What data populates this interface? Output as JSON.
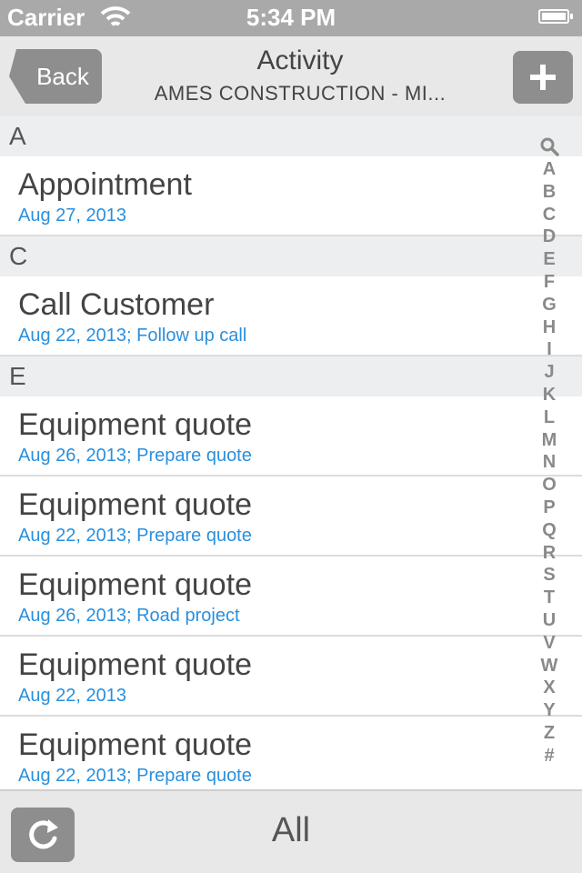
{
  "status_bar": {
    "carrier": "Carrier",
    "time": "5:34 PM"
  },
  "nav": {
    "back_label": "Back",
    "title": "Activity",
    "subtitle": "AMES CONSTRUCTION - MI...",
    "add_icon": "plus-icon"
  },
  "sections": [
    {
      "letter": "A",
      "rows": [
        {
          "title": "Appointment",
          "subtitle": "Aug 27, 2013"
        }
      ]
    },
    {
      "letter": "C",
      "rows": [
        {
          "title": "Call Customer",
          "subtitle": "Aug 22, 2013; Follow up call"
        }
      ]
    },
    {
      "letter": "E",
      "rows": [
        {
          "title": "Equipment quote",
          "subtitle": "Aug 26, 2013; Prepare quote"
        },
        {
          "title": "Equipment quote",
          "subtitle": "Aug 22, 2013; Prepare quote"
        },
        {
          "title": "Equipment quote",
          "subtitle": "Aug 26, 2013; Road project"
        },
        {
          "title": "Equipment quote",
          "subtitle": "Aug 22, 2013"
        },
        {
          "title": "Equipment quote",
          "subtitle": "Aug 22, 2013; Prepare quote"
        }
      ]
    }
  ],
  "index": [
    "A",
    "B",
    "C",
    "D",
    "E",
    "F",
    "G",
    "H",
    "I",
    "J",
    "K",
    "L",
    "M",
    "N",
    "O",
    "P",
    "Q",
    "R",
    "S",
    "T",
    "U",
    "V",
    "W",
    "X",
    "Y",
    "Z",
    "#"
  ],
  "toolbar": {
    "filter_label": "All",
    "refresh_icon": "refresh-icon"
  },
  "colors": {
    "accent_blue": "#2a8fdc",
    "button_gray": "#8e8e8e"
  }
}
